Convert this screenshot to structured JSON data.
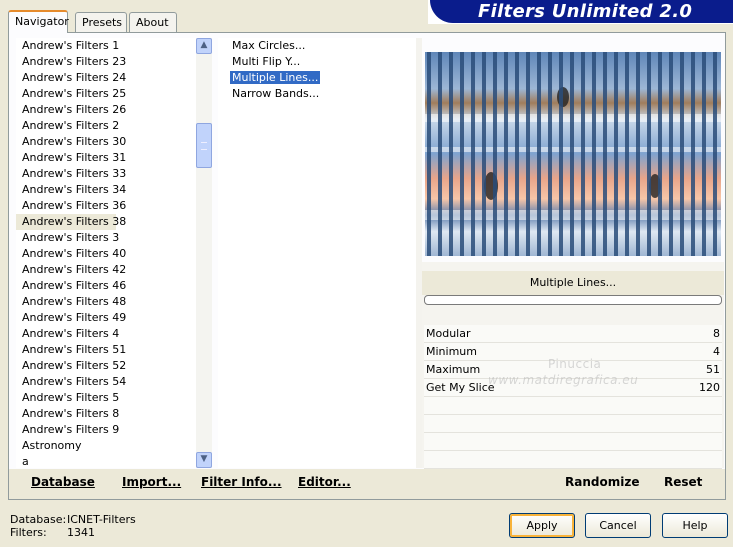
{
  "tabs": [
    "Navigator",
    "Presets",
    "About"
  ],
  "banner_title": "Filters Unlimited 2.0",
  "categories": [
    "Andrew's Filters 1",
    "Andrew's Filters 23",
    "Andrew's Filters 24",
    "Andrew's Filters 25",
    "Andrew's Filters 26",
    "Andrew's Filters 2",
    "Andrew's Filters 30",
    "Andrew's Filters 31",
    "Andrew's Filters 33",
    "Andrew's Filters 34",
    "Andrew's Filters 36",
    "Andrew's Filters 38",
    "Andrew's Filters 3",
    "Andrew's Filters 40",
    "Andrew's Filters 42",
    "Andrew's Filters 46",
    "Andrew's Filters 48",
    "Andrew's Filters 49",
    "Andrew's Filters 4",
    "Andrew's Filters 51",
    "Andrew's Filters 52",
    "Andrew's Filters 54",
    "Andrew's Filters 5",
    "Andrew's Filters 8",
    "Andrew's Filters 9",
    "Astronomy",
    "a"
  ],
  "selected_category": "Andrew's Filters 38",
  "filters": [
    "Max Circles...",
    "Multi Flip Y...",
    "Multiple Lines...",
    "Narrow Bands..."
  ],
  "selected_filter": "Multiple Lines...",
  "filter_name_display": "Multiple Lines...",
  "progress": 0,
  "parameters": [
    {
      "label": "Modular",
      "value": "8"
    },
    {
      "label": "Minimum",
      "value": "4"
    },
    {
      "label": "Maximum",
      "value": "51"
    },
    {
      "label": "Get My Slice",
      "value": "120"
    }
  ],
  "watermark": {
    "line1": "Pinuccia",
    "line2": "www.matdiregrafica.eu"
  },
  "bottom_buttons": {
    "database": "Database",
    "import": "Import...",
    "filter_info": "Filter Info...",
    "editor": "Editor...",
    "randomize": "Randomize",
    "reset": "Reset"
  },
  "status": {
    "database_label": "Database:",
    "database_value": "ICNET-Filters",
    "filters_label": "Filters:",
    "filters_value": "1341"
  },
  "dialog_buttons": {
    "apply": "Apply",
    "cancel": "Cancel",
    "help": "Help"
  },
  "icons": {
    "scroll_up": "scroll-up-icon",
    "scroll_down": "scroll-down-icon"
  },
  "colors": {
    "banner": "#0a1c8c",
    "selection": "#316ac5",
    "default_button_glow": "#f8b33a"
  }
}
